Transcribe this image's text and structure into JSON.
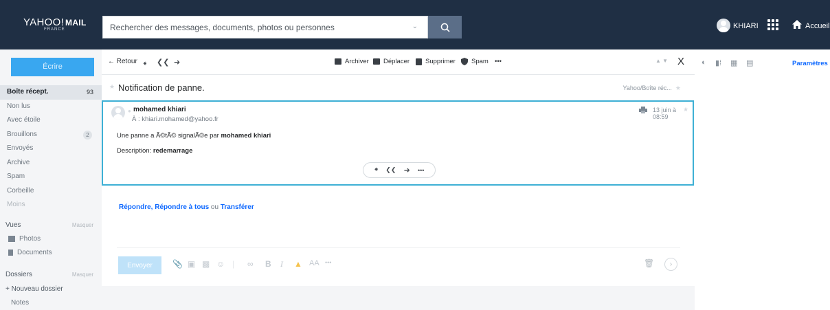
{
  "header": {
    "logo_text": "YAHOO!",
    "logo_mail": "MAIL",
    "logo_sub": "FRANCE",
    "search_placeholder": "Rechercher des messages, documents, photos ou personnes",
    "user_name": "KHIARI",
    "home_label": "Accueil",
    "colors": {
      "bg": "#1f2f44",
      "search_button": "#5b6e88"
    }
  },
  "sidebar": {
    "compose_label": "Écrire",
    "folders": [
      {
        "label": "Boîte récept.",
        "count": "93",
        "active": true
      },
      {
        "label": "Non lus"
      },
      {
        "label": "Avec étoile"
      },
      {
        "label": "Brouillons",
        "badge": "2"
      },
      {
        "label": "Envoyés"
      },
      {
        "label": "Archive"
      },
      {
        "label": "Spam"
      },
      {
        "label": "Corbeille"
      },
      {
        "label": "Moins"
      }
    ],
    "views_label": "Vues",
    "views_hide": "Masquer",
    "views": [
      {
        "label": "Photos",
        "icon": "photo-icon"
      },
      {
        "label": "Documents",
        "icon": "document-icon"
      }
    ],
    "folders_label": "Dossiers",
    "folders_hide": "Masquer",
    "new_folder": "+ Nouveau dossier",
    "notes": "Notes"
  },
  "toolbar": {
    "back": "← Retour",
    "archive": "Archiver",
    "move": "Déplacer",
    "delete": "Supprimer",
    "spam": "Spam",
    "more": "•••",
    "close": "X"
  },
  "message": {
    "subject": "Notification de panne.",
    "folder_path": "Yahoo/Boîte réc...",
    "sender": "mohamed khiari",
    "recipient": "À : khiari.mohamed@yahoo.fr",
    "date": "13 juin à 08:59",
    "body_line1_prefix": "Une panne a Ã©tÃ© signalÃ©e par ",
    "body_line1_name": "mohamed khiari",
    "body_line2_prefix": "Description: ",
    "body_line2_value": "redemarrage"
  },
  "reply": {
    "reply_label": "Répondre",
    "reply_all_label": "Répondre à tous",
    "or_label": "ou",
    "forward_label": "Transférer",
    "send_label": "Envoyer",
    "more": "•••"
  },
  "right_panel": {
    "settings_label": "Paramètres"
  }
}
